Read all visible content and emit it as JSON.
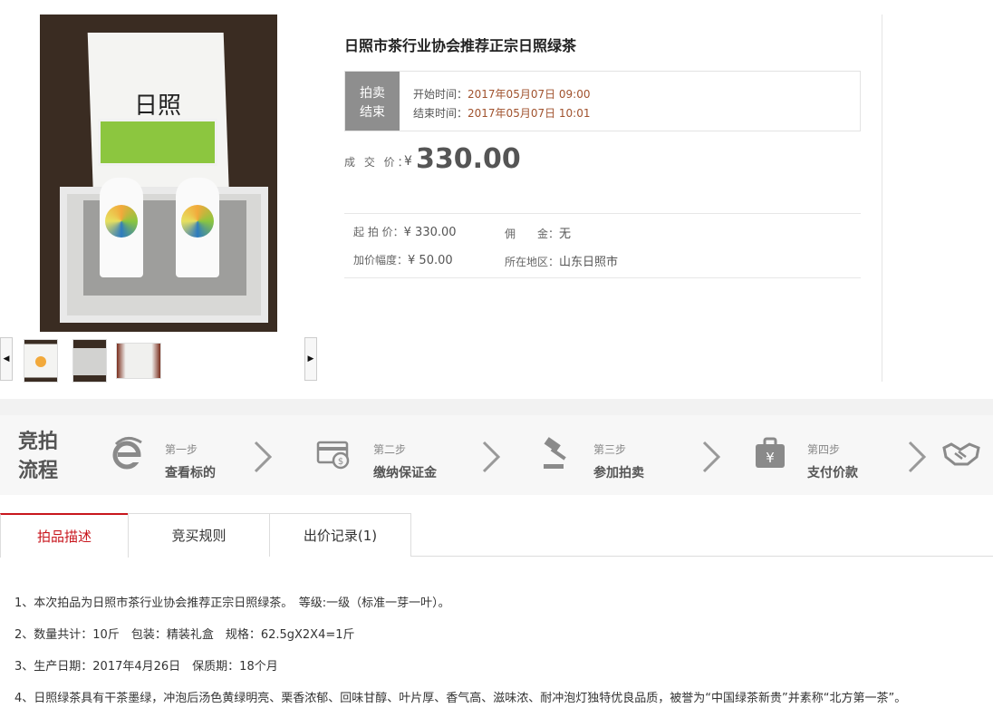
{
  "item": {
    "title": "日照市茶行业协会推荐正宗日照绿茶",
    "time_tag_line1": "拍卖",
    "time_tag_line2": "结束",
    "start_label": "开始时间：",
    "start_value": "2017年05月07日 09:00",
    "end_label": "结束时间：",
    "end_value": "2017年05月07日 10:01",
    "deal_label": "成 交 价：",
    "currency": "¥",
    "deal_price": "330.00",
    "start_price_label": "起 拍 价：",
    "start_price": "¥ 330.00",
    "commission_label": "佣　　金：",
    "commission": "无",
    "increment_label": "加价幅度：",
    "increment": "¥ 50.00",
    "region_label": "所在地区：",
    "region": "山东日照市"
  },
  "flow": {
    "title_line1": "竞拍",
    "title_line2": "流程",
    "steps": [
      {
        "no": "第一步",
        "name": "查看标的",
        "icon": "ie-icon"
      },
      {
        "no": "第二步",
        "name": "缴纳保证金",
        "icon": "card-icon"
      },
      {
        "no": "第三步",
        "name": "参加拍卖",
        "icon": "gavel-icon"
      },
      {
        "no": "第四步",
        "name": "支付价款",
        "icon": "bag-yen-icon"
      }
    ],
    "handshake_icon": "handshake-icon",
    "bag_symbol": "¥"
  },
  "tabs": [
    {
      "label": "拍品描述"
    },
    {
      "label": "竞买规则"
    },
    {
      "label": "出价记录(1)"
    }
  ],
  "description": [
    "1、本次拍品为日照市茶行业协会推荐正宗日照绿茶。　等级:一级（标准一芽一叶）。",
    "2、数量共计：10斤　包装：精装礼盒　规格：62.5gX2X4=1斤",
    "3、生产日期：2017年4月26日　保质期：18个月",
    "4、日照绿茶具有干茶墨绿，冲泡后汤色黄绿明亮、栗香浓郁、回味甘醇、叶片厚、香气高、滋味浓、耐冲泡灯独特优良品质，被誉为“中国绿茶新贵”并素称“北方第一茶”。"
  ],
  "colors": {
    "accent": "#c8161d",
    "tag": "#8e8e8e",
    "time": "#a0522d"
  }
}
